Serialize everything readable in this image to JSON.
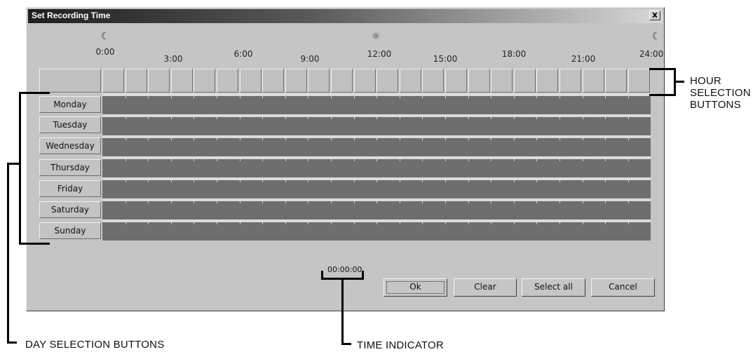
{
  "window": {
    "title": "Set Recording Time",
    "close_label": "x"
  },
  "timeline": {
    "labels": [
      "0:00",
      "3:00",
      "6:00",
      "9:00",
      "12:00",
      "15:00",
      "18:00",
      "21:00",
      "24:00"
    ],
    "hour_button_count": 24
  },
  "days": [
    "Monday",
    "Tuesday",
    "Wednesday",
    "Thursday",
    "Friday",
    "Saturday",
    "Sunday"
  ],
  "time_indicator": "00:00:00",
  "buttons": {
    "ok": "Ok",
    "clear": "Clear",
    "select_all": "Select all",
    "cancel": "Cancel"
  },
  "callouts": {
    "hour_selection": "HOUR SELECTION BUTTONS",
    "day_selection": "DAY SELECTION BUTTONS",
    "time_indicator": "TIME INDICATOR"
  },
  "icons": {
    "night": "moon-icon",
    "day": "sun-icon"
  }
}
